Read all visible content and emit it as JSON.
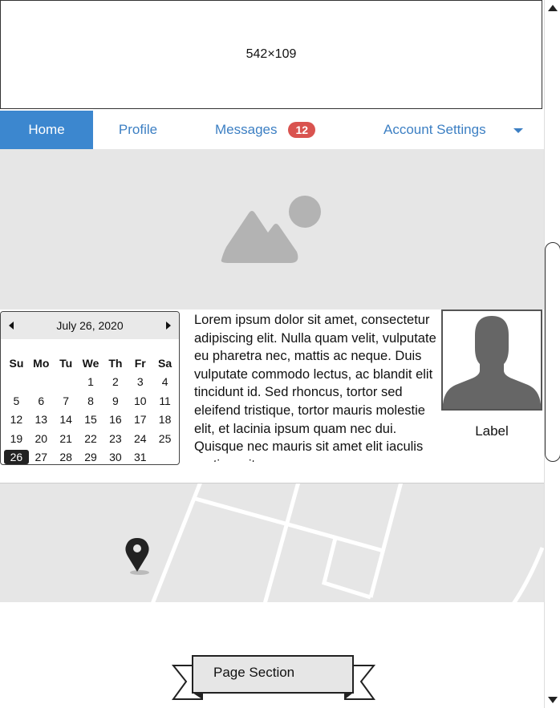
{
  "banner": {
    "text": "542×109"
  },
  "nav": {
    "home": "Home",
    "profile": "Profile",
    "messages": "Messages",
    "messages_badge": "12",
    "account": "Account Settings"
  },
  "calendar": {
    "title": "July 26, 2020",
    "weekdays": [
      "Su",
      "Mo",
      "Tu",
      "We",
      "Th",
      "Fr",
      "Sa"
    ],
    "weeks": [
      [
        "",
        "",
        "",
        "1",
        "2",
        "3",
        "4"
      ],
      [
        "5",
        "6",
        "7",
        "8",
        "9",
        "10",
        "11"
      ],
      [
        "12",
        "13",
        "14",
        "15",
        "16",
        "17",
        "18"
      ],
      [
        "19",
        "20",
        "21",
        "22",
        "23",
        "24",
        "25"
      ],
      [
        "26",
        "27",
        "28",
        "29",
        "30",
        "31",
        ""
      ]
    ],
    "selected": "26"
  },
  "paragraph": "Lorem ipsum dolor sit amet, consectetur adipiscing elit. Nulla quam velit, vulputate eu pharetra nec, mattis ac neque. Duis vulputate commodo lectus, ac blandit elit tincidunt id. Sed rhoncus, tortor sed eleifend tristique, tortor mauris molestie elit, et lacinia ipsum quam nec dui. Quisque nec mauris sit amet elit iaculis pretium sit",
  "avatar": {
    "label": "Label"
  },
  "section": {
    "label": "Page Section"
  },
  "colors": {
    "nav_active": "#3c87cf",
    "nav_link": "#3c7fc3",
    "badge": "#d9534f",
    "placeholder": "#e6e6e6"
  }
}
